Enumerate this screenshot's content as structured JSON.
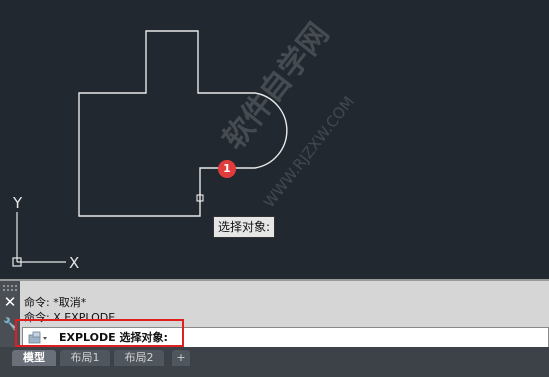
{
  "canvas": {
    "tooltip": "选择对象:",
    "marker_label": "1",
    "ucs": {
      "y_label": "Y",
      "x_label": "X"
    },
    "watermark": {
      "text": "软件自学网",
      "url": "WWW.RJZXW.COM"
    }
  },
  "command": {
    "history": [
      "命令: *取消*",
      "命令: X EXPLODE"
    ],
    "input_text": "EXPLODE 选择对象:"
  },
  "tabs": [
    {
      "label": "模型",
      "active": true
    },
    {
      "label": "布局1",
      "active": false
    },
    {
      "label": "布局2",
      "active": false
    },
    {
      "label": "+",
      "active": false
    }
  ],
  "colors": {
    "canvas_bg": "#212830",
    "highlight": "#e02020",
    "marker": "#e23b3b"
  }
}
